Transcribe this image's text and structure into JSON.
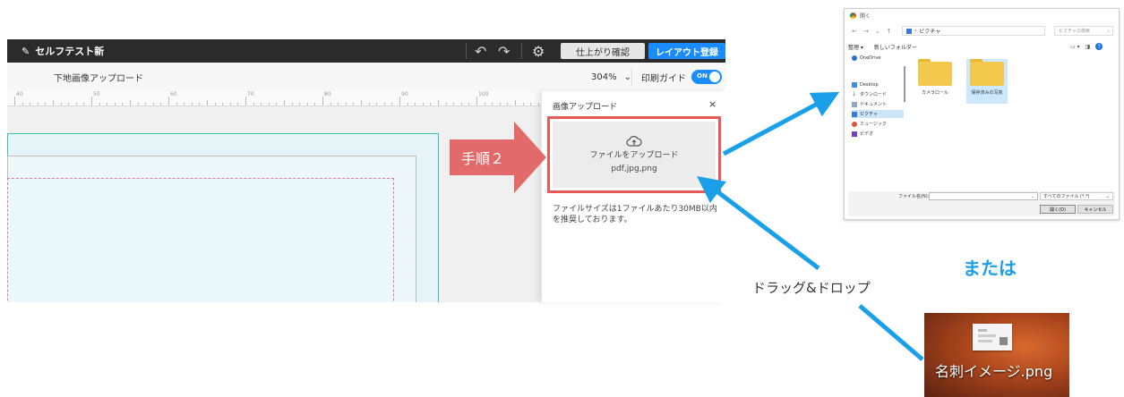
{
  "editor": {
    "title": "セルフテスト新",
    "confirm_button": "仕上がり確認",
    "register_button": "レイアウト登録",
    "toolbar_label": "下地画像アップロード",
    "zoom": "304%",
    "print_guide_label": "印刷ガイド",
    "toggle_label": "ON",
    "ruler_numbers": [
      "40",
      "50",
      "60",
      "70",
      "80",
      "90",
      "100"
    ]
  },
  "panel": {
    "title": "画像アップロード",
    "close": "×",
    "upload_text": "ファイルをアップロード",
    "upload_types": "pdf,jpg,png",
    "note": "ファイルサイズは1ファイルあたり30MB以内を推奨しております。"
  },
  "step_label": "手順２",
  "dialog": {
    "title": "開く",
    "address": "ピクチャ",
    "search_placeholder": "ピクチャの検索",
    "organize": "整理 ▾",
    "new_folder": "新しいフォルダー",
    "nav_items": [
      "OneDrive",
      "Desktop",
      "ダウンロード",
      "ドキュメント",
      "ピクチャ",
      "ミュージック",
      "ビデオ"
    ],
    "folders": [
      "カメラロール",
      "保存済みの写真"
    ],
    "filename_label": "ファイル名(N):",
    "filetype": "すべてのファイル (*.*)",
    "open_button": "開く(O)",
    "cancel_button": "キャンセル"
  },
  "or_text": "または",
  "drag_drop_label": "ドラッグ&ドロップ",
  "desktop_file": "名刺イメージ.png",
  "colors": {
    "accent_blue": "#1a8cff",
    "arrow_blue": "#1aa0e8",
    "step_red": "#e36a6a"
  }
}
